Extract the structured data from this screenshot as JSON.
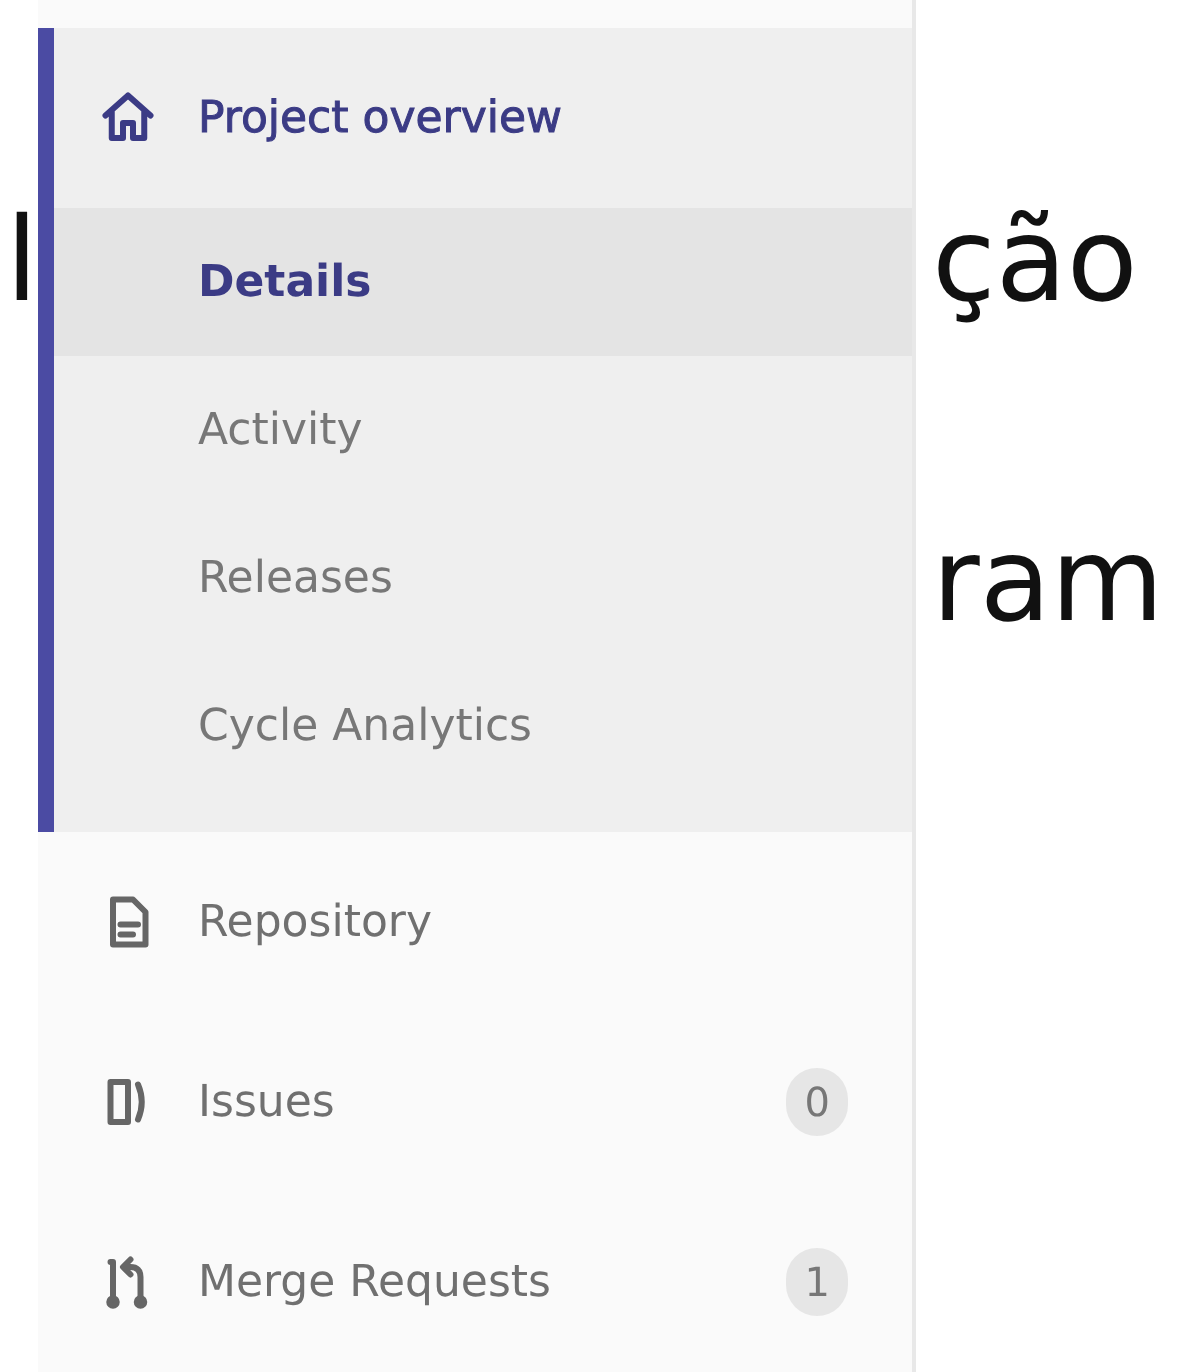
{
  "page_text": {
    "left": [
      "l"
    ],
    "right": [
      "ção",
      "ram"
    ]
  },
  "sidebar": {
    "items": [
      {
        "label": "Project overview",
        "kind": "home",
        "selected": true,
        "children": [
          {
            "label": "Details",
            "selected": true
          },
          {
            "label": "Activity",
            "selected": false
          },
          {
            "label": "Releases",
            "selected": false
          },
          {
            "label": "Cycle Analytics",
            "selected": false
          }
        ]
      },
      {
        "label": "Repository",
        "kind": "document",
        "selected": false
      },
      {
        "label": "Issues",
        "kind": "issues",
        "count": "0",
        "selected": false
      },
      {
        "label": "Merge Requests",
        "kind": "merge",
        "count": "1",
        "selected": false
      }
    ]
  }
}
